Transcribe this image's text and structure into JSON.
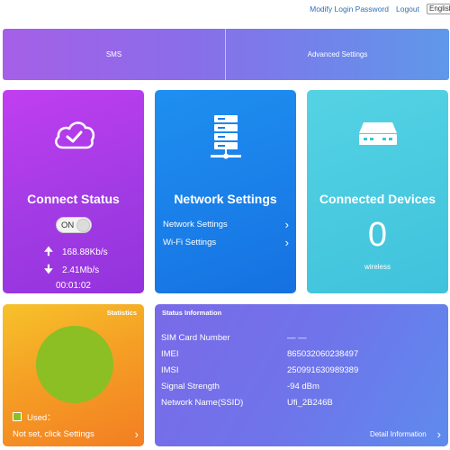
{
  "header": {
    "links": [
      "Modify Login Password",
      "Logout"
    ],
    "language": "English"
  },
  "nav": {
    "items": [
      "SMS",
      "Advanced Settings"
    ]
  },
  "connect": {
    "title": "Connect Status",
    "toggle": "ON",
    "upload": "168.88Kb/s",
    "download": "2.41Mb/s",
    "duration": "00:01:02",
    "icon": "cloud-check-icon"
  },
  "network": {
    "title": "Network Settings",
    "links": [
      "Network Settings",
      "Wi-Fi Settings"
    ],
    "icon": "server-icon"
  },
  "devices": {
    "title": "Connected Devices",
    "count": "0",
    "sub": "wireless",
    "icon": "router-icon"
  },
  "statistics": {
    "title": "Statistics",
    "legend": "Used：",
    "notset": "Not set, click Settings",
    "pie_color": "#8bbf24"
  },
  "status": {
    "title": "Status Information",
    "rows": [
      {
        "label": "SIM Card Number",
        "value": "— —"
      },
      {
        "label": "IMEI",
        "value": "865032060238497"
      },
      {
        "label": "IMSI",
        "value": "250991630989389"
      },
      {
        "label": "Signal Strength",
        "value": "-94 dBm"
      },
      {
        "label": "Network Name(SSID)",
        "value": "Ufi_2B246B"
      }
    ],
    "detail": "Detail Information"
  }
}
